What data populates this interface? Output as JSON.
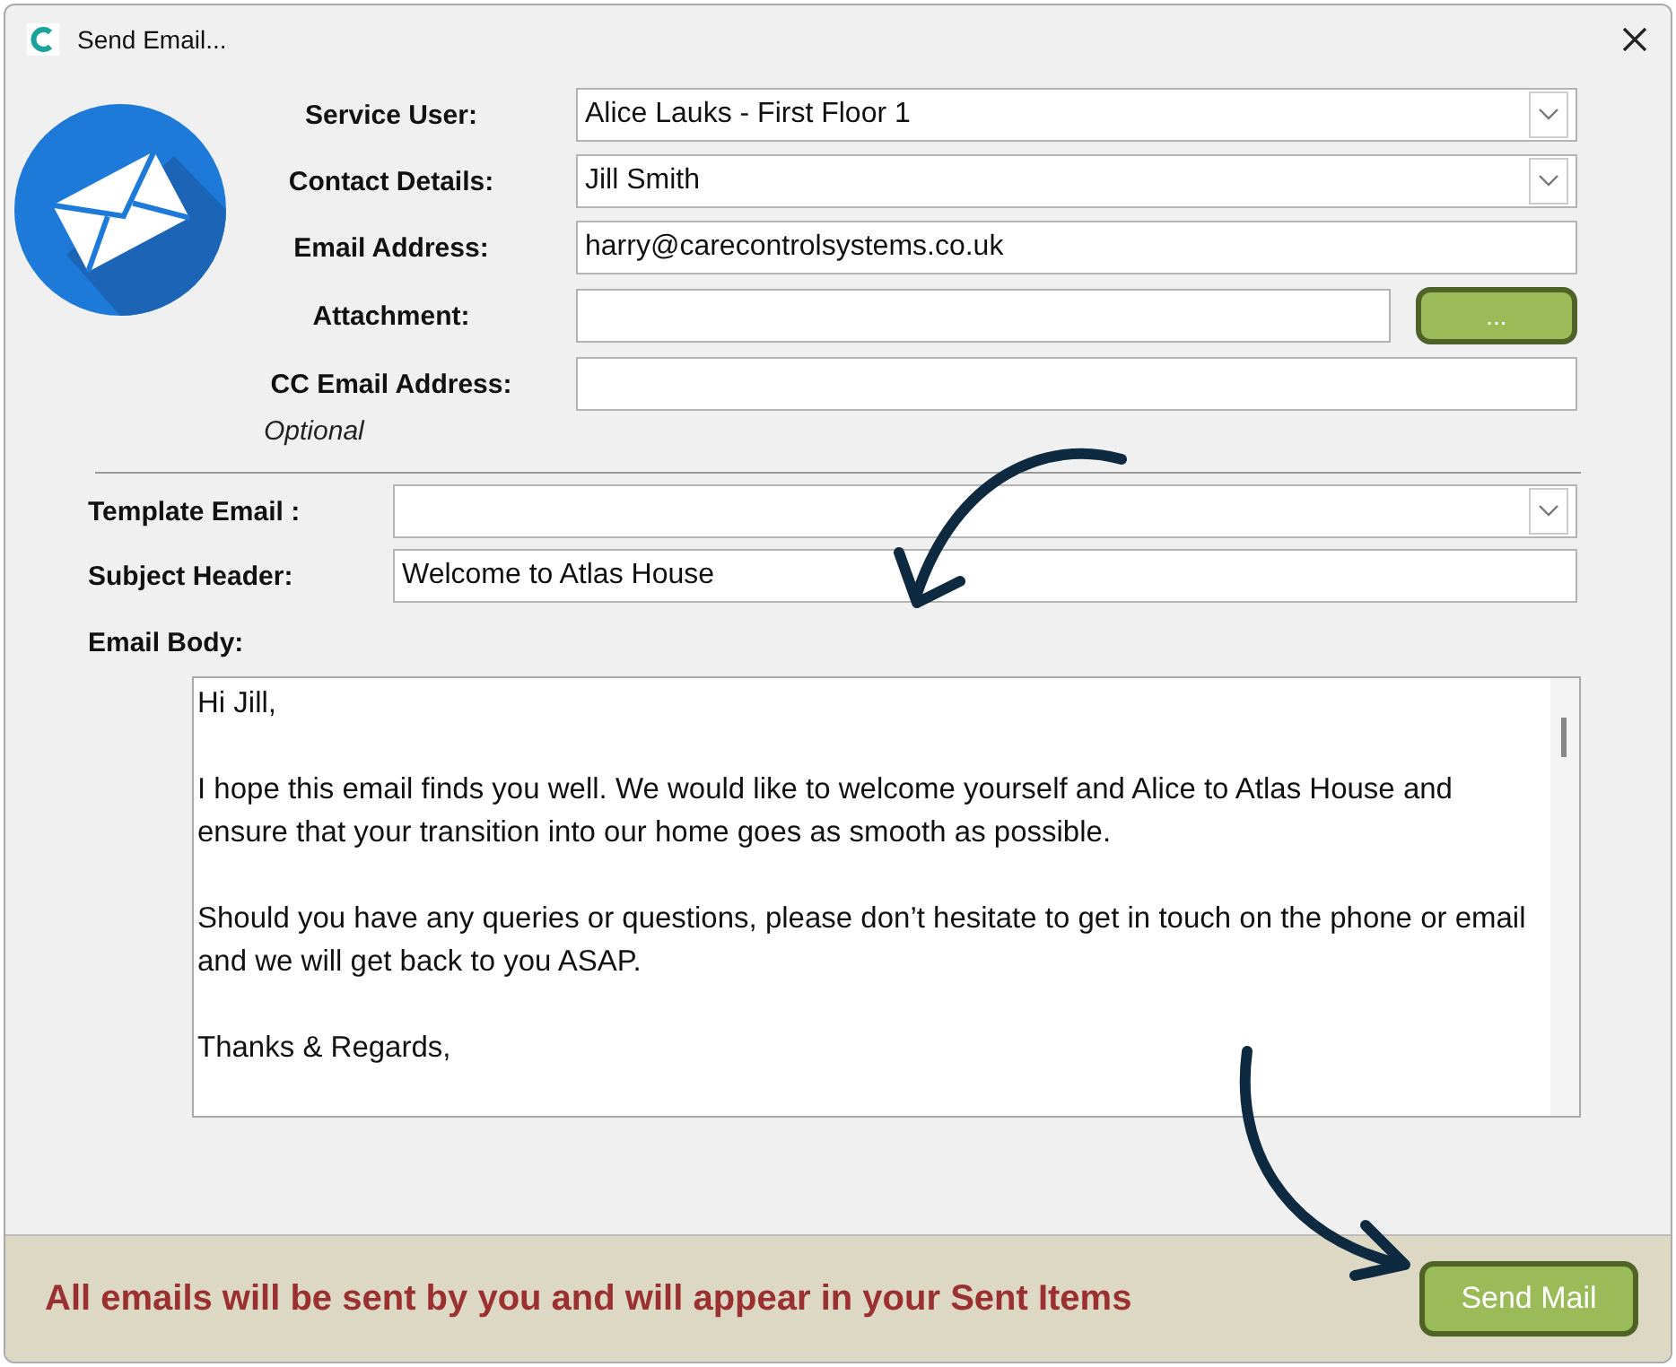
{
  "window": {
    "title": "Send Email..."
  },
  "recipient_fields": [
    {
      "kind": "dropdown",
      "label": "Service User:",
      "value": "Alice Lauks - First Floor 1"
    },
    {
      "kind": "dropdown",
      "label": "Contact Details:",
      "value": "Jill Smith"
    },
    {
      "kind": "text",
      "label": "Email Address:",
      "value": "harry@carecontrolsystems.co.uk"
    },
    {
      "kind": "browse",
      "label": "Attachment:",
      "button": "..."
    },
    {
      "kind": "text",
      "label": "CC Email Address:",
      "hint": "Optional"
    }
  ],
  "message_fields": [
    {
      "kind": "dropdown",
      "label": "Template Email :"
    },
    {
      "kind": "text",
      "label": "Subject Header:",
      "value": "Welcome to Atlas House"
    }
  ],
  "body": {
    "label": "Email Body:",
    "paragraphs": [
      "Hi Jill,",
      "I hope this email finds you well. We would like to welcome yourself and Alice to Atlas House and ensure that your transition into our home goes as smooth as possible.",
      "Should you have any queries or questions, please don’t hesitate to get in touch on the phone or email and we will get back to you ASAP.",
      "Thanks & Regards,"
    ]
  },
  "footer": {
    "notice": "All emails will be sent by you and will appear in your Sent Items",
    "button": "Send Mail"
  }
}
